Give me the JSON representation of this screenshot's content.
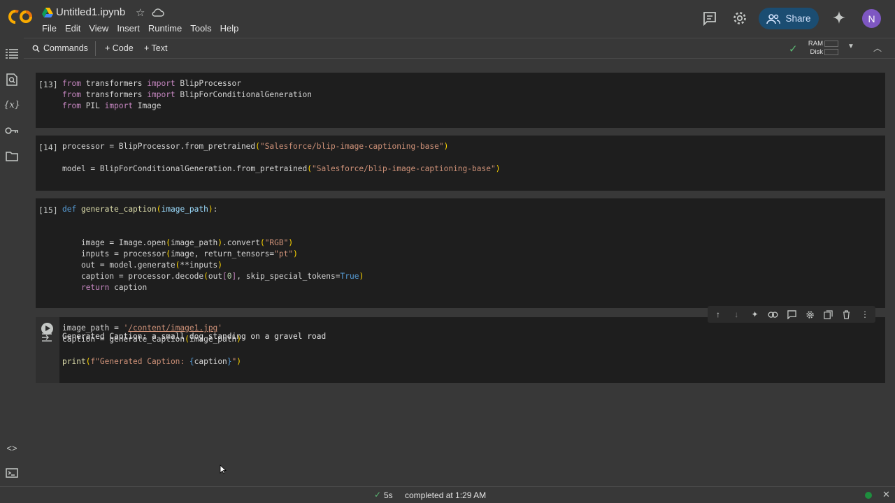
{
  "header": {
    "title": "Untitled1.ipynb",
    "menu": [
      "File",
      "Edit",
      "View",
      "Insert",
      "Runtime",
      "Tools",
      "Help"
    ],
    "share_label": "Share",
    "avatar_initial": "N"
  },
  "toolbar": {
    "commands_label": "Commands",
    "code_label": "+ Code",
    "text_label": "+ Text",
    "ram_label": "RAM",
    "disk_label": "Disk"
  },
  "cells": [
    {
      "count": "[13]",
      "lines": [
        "from transformers import BlipProcessor",
        "from transformers import BlipForConditionalGeneration",
        "from PIL import Image"
      ]
    },
    {
      "count": "[14]",
      "lines": [
        "processor = BlipProcessor.from_pretrained(\"Salesforce/blip-image-captioning-base\")",
        "",
        "model = BlipForConditionalGeneration.from_pretrained(\"Salesforce/blip-image-captioning-base\")"
      ]
    },
    {
      "count": "[15]",
      "lines": [
        "def generate_caption(image_path):",
        "",
        "",
        "    image = Image.open(image_path).convert(\"RGB\")",
        "    inputs = processor(image, return_tensors=\"pt\")",
        "    out = model.generate(**inputs)",
        "    caption = processor.decode(out[0], skip_special_tokens=True)",
        "    return caption"
      ]
    },
    {
      "count": "",
      "lines": [
        "image_path = '/content/image1.jpg'",
        "caption = generate_caption(image_path)",
        "",
        "print(f\"Generated Caption: {caption}\")"
      ]
    }
  ],
  "output": {
    "text": "Generated Caption: a small dog standing on a gravel road"
  },
  "status": {
    "duration": "5s",
    "message": "completed at 1:29 AM"
  },
  "colors": {
    "accent_green": "#5bb974",
    "share_bg": "#1b4d72",
    "avatar_bg": "#7e57c2"
  }
}
